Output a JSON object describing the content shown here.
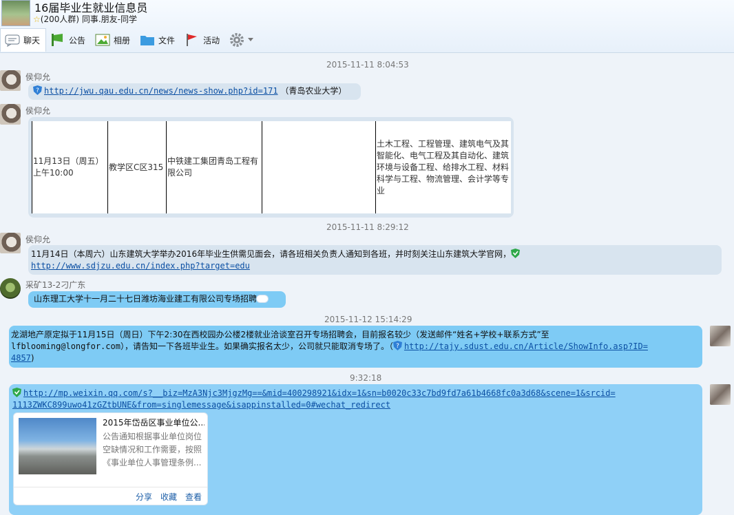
{
  "header": {
    "group_name": "16届毕业生就业信息员",
    "star": "☆",
    "group_meta": "(200人群) 同事.朋友-同学",
    "tabs": [
      {
        "label": "聊天"
      },
      {
        "label": "公告"
      },
      {
        "label": "相册"
      },
      {
        "label": "文件"
      },
      {
        "label": "活动"
      }
    ]
  },
  "chat": {
    "time1": "2015-11-11 8:04:53",
    "msg1": {
      "sender": "侯仰允",
      "link": "http://jwu.qau.edu.cn/news/news-show.php?id=171",
      "text": "（青岛农业大学）"
    },
    "msg2": {
      "sender": "侯仰允",
      "row": {
        "date": "11月13日（周五）",
        "time": "上午10:00",
        "place": "教学区C区315",
        "company": "中铁建工集团青岛工程有限公司",
        "majors": "土木工程、工程管理、建筑电气及其智能化、电气工程及其自动化、建筑环境与设备工程、给排水工程、材料科学与工程、物流管理、会计学等专业"
      }
    },
    "time2": "2015-11-11 8:29:12",
    "msg3": {
      "sender": "侯仰允",
      "text": "11月14日（本周六）山东建筑大学举办2016年毕业生供需见面会，请各班相关负责人通知到各班，并时刻关注山东建筑大学官网，",
      "link": "http://www.sdjzu.edu.cn/index.php?target=edu"
    },
    "msg4": {
      "sender": "采矿13-2刁广东",
      "text": "山东理工大学十一月二十七日潍坊海业建工有限公司专场招聘"
    },
    "time3": "2015-11-12 15:14:29",
    "msg5": {
      "line1": "龙湖地产原定拟于11月15日（周日）下午2:30在西校园办公楼2楼就业洽谈室召开专场招聘会，目前报名较少（发送邮件“姓名+学校+联系方式”至",
      "line2": "lfblooming@longfor.com），请告知一下各班毕业生。如果确实报名太少，公司就只能取消专场了。（",
      "link_a": "http://tajy.sdust.edu.cn/Article/ShowInfo.asp?ID=",
      "link_b": "4857",
      "tail": ")"
    },
    "time4": "9:32:18",
    "msg6": {
      "link_a": "http://mp.weixin.qq.com/s?__biz=MzA3Njc3MjgzMg==&mid=400298921&idx=1&sn=b0020c33c7bd9fd7a61b4668fc0a3d68&scene=1&srcid=",
      "link_b": "1113ZWKC899uwo41zGZtbUNE&from=singlemessage&isappinstalled=0#wechat_redirect",
      "card": {
        "title": "2015年岱岳区事业单位公...",
        "desc": "公告通知根据事业单位岗位空缺情况和工作需要，按照《事业单位人事管理条例...",
        "share": "分享",
        "collect": "收藏",
        "view": "查看"
      }
    }
  },
  "colors": {
    "bubble_gray": "#d8e4ef",
    "bubble_blue": "#7ecbf5",
    "link": "#0b4fa3"
  }
}
